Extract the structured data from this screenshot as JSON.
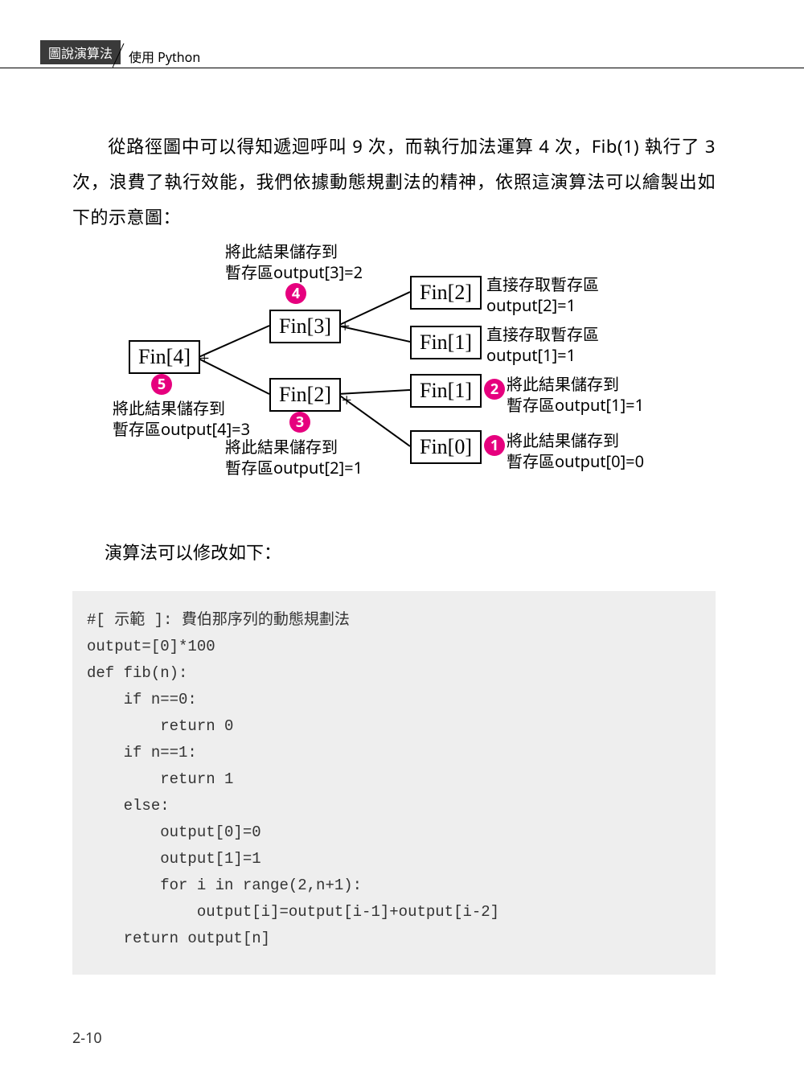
{
  "header": {
    "tab": "圖說演算法",
    "sub": "使用 Python"
  },
  "intro": {
    "text": "從路徑圖中可以得知遞迴呼叫 9 次，而執行加法運算 4 次，Fib(1) 執行了 3 次，浪費了執行效能，我們依據動態規劃法的精神，依照這演算法可以繪製出如下的示意圖："
  },
  "diagram": {
    "nodes": {
      "fin4": "Fin[4]",
      "fin3": "Fin[3]",
      "fin2a": "Fin[2]",
      "fin2b": "Fin[2]",
      "fin1a": "Fin[1]",
      "fin1b": "Fin[1]",
      "fin0": "Fin[0]"
    },
    "badges": {
      "b1": "1",
      "b2": "2",
      "b3": "3",
      "b4": "4",
      "b5": "5"
    },
    "plus": "+",
    "ann": {
      "a4l1": "將此結果儲存到",
      "a4l2": "暫存區output[3]=2",
      "a5l1": "將此結果儲存到",
      "a5l2": "暫存區output[4]=3",
      "a3l1": "將此結果儲存到",
      "a3l2": "暫存區output[2]=1",
      "r2al1": "直接存取暫存區",
      "r2al2": "output[2]=1",
      "r1al1": "直接存取暫存區",
      "r1al2": "output[1]=1",
      "r2l1": "將此結果儲存到",
      "r2l2": "暫存區output[1]=1",
      "r1l1": "將此結果儲存到",
      "r1l2": "暫存區output[0]=0"
    }
  },
  "para2": "演算法可以修改如下：",
  "code": [
    "#[ 示範 ]: 費伯那序列的動態規劃法",
    "",
    "output=[0]*100",
    "",
    "def fib(n):",
    "    if n==0:",
    "        return 0",
    "    if n==1:",
    "        return 1",
    "    else:",
    "        output[0]=0",
    "        output[1]=1",
    "        for i in range(2,n+1):",
    "            output[i]=output[i-1]+output[i-2]",
    "    return output[n]"
  ],
  "pageNum": "2-10"
}
